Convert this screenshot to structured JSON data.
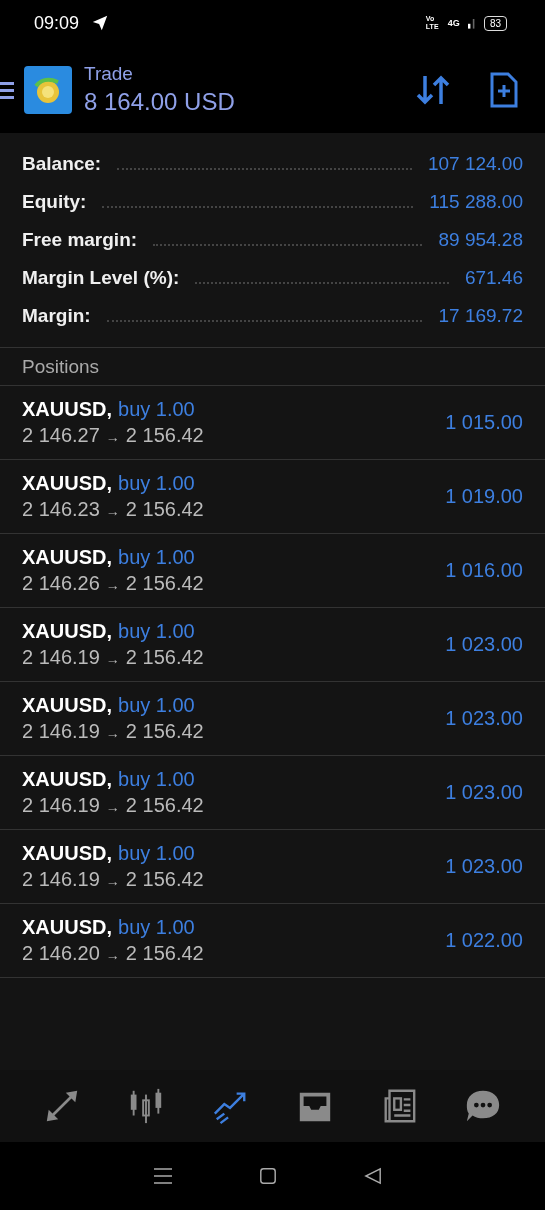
{
  "status_bar": {
    "time": "09:09",
    "volte": "Vo LTE",
    "network": "4G",
    "battery": "83"
  },
  "header": {
    "title": "Trade",
    "balance": "8 164.00 USD"
  },
  "summary": [
    {
      "label": "Balance:",
      "value": "107 124.00"
    },
    {
      "label": "Equity:",
      "value": "115 288.00"
    },
    {
      "label": "Free margin:",
      "value": "89 954.28"
    },
    {
      "label": "Margin Level (%):",
      "value": "671.46"
    },
    {
      "label": "Margin:",
      "value": "17 169.72"
    }
  ],
  "positions_title": "Positions",
  "positions": [
    {
      "symbol": "XAUUSD,",
      "side": "buy 1.00",
      "open": "2 146.27",
      "arrow": "→",
      "current": "2 156.42",
      "profit": "1 015.00"
    },
    {
      "symbol": "XAUUSD,",
      "side": "buy 1.00",
      "open": "2 146.23",
      "arrow": "→",
      "current": "2 156.42",
      "profit": "1 019.00"
    },
    {
      "symbol": "XAUUSD,",
      "side": "buy 1.00",
      "open": "2 146.26",
      "arrow": "→",
      "current": "2 156.42",
      "profit": "1 016.00"
    },
    {
      "symbol": "XAUUSD,",
      "side": "buy 1.00",
      "open": "2 146.19",
      "arrow": "→",
      "current": "2 156.42",
      "profit": "1 023.00"
    },
    {
      "symbol": "XAUUSD,",
      "side": "buy 1.00",
      "open": "2 146.19",
      "arrow": "→",
      "current": "2 156.42",
      "profit": "1 023.00"
    },
    {
      "symbol": "XAUUSD,",
      "side": "buy 1.00",
      "open": "2 146.19",
      "arrow": "→",
      "current": "2 156.42",
      "profit": "1 023.00"
    },
    {
      "symbol": "XAUUSD,",
      "side": "buy 1.00",
      "open": "2 146.19",
      "arrow": "→",
      "current": "2 156.42",
      "profit": "1 023.00"
    },
    {
      "symbol": "XAUUSD,",
      "side": "buy 1.00",
      "open": "2 146.20",
      "arrow": "→",
      "current": "2 156.42",
      "profit": "1 022.00"
    }
  ],
  "bottom_nav": [
    {
      "kind": "quotes",
      "selected": false
    },
    {
      "kind": "chart",
      "selected": false
    },
    {
      "kind": "trade",
      "selected": true
    },
    {
      "kind": "history",
      "selected": false
    },
    {
      "kind": "news",
      "selected": false
    },
    {
      "kind": "chat",
      "selected": false
    }
  ]
}
